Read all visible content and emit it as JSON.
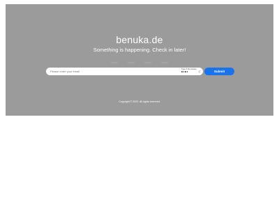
{
  "site": {
    "title": "benuka.de",
    "tagline": "Something is happening. Check in later!"
  },
  "countdown": {
    "units": [
      "",
      "",
      "",
      ""
    ]
  },
  "subscribe": {
    "email_placeholder": "Please enter your email",
    "email_value": "",
    "captcha_label": "Type in the answer",
    "submit_label": "Submit"
  },
  "footer": {
    "copyright": "Copyright © 2022. All rights reserved."
  },
  "colors": {
    "hero_background": "#9b9b9b",
    "submit_button": "#1a73e8"
  }
}
